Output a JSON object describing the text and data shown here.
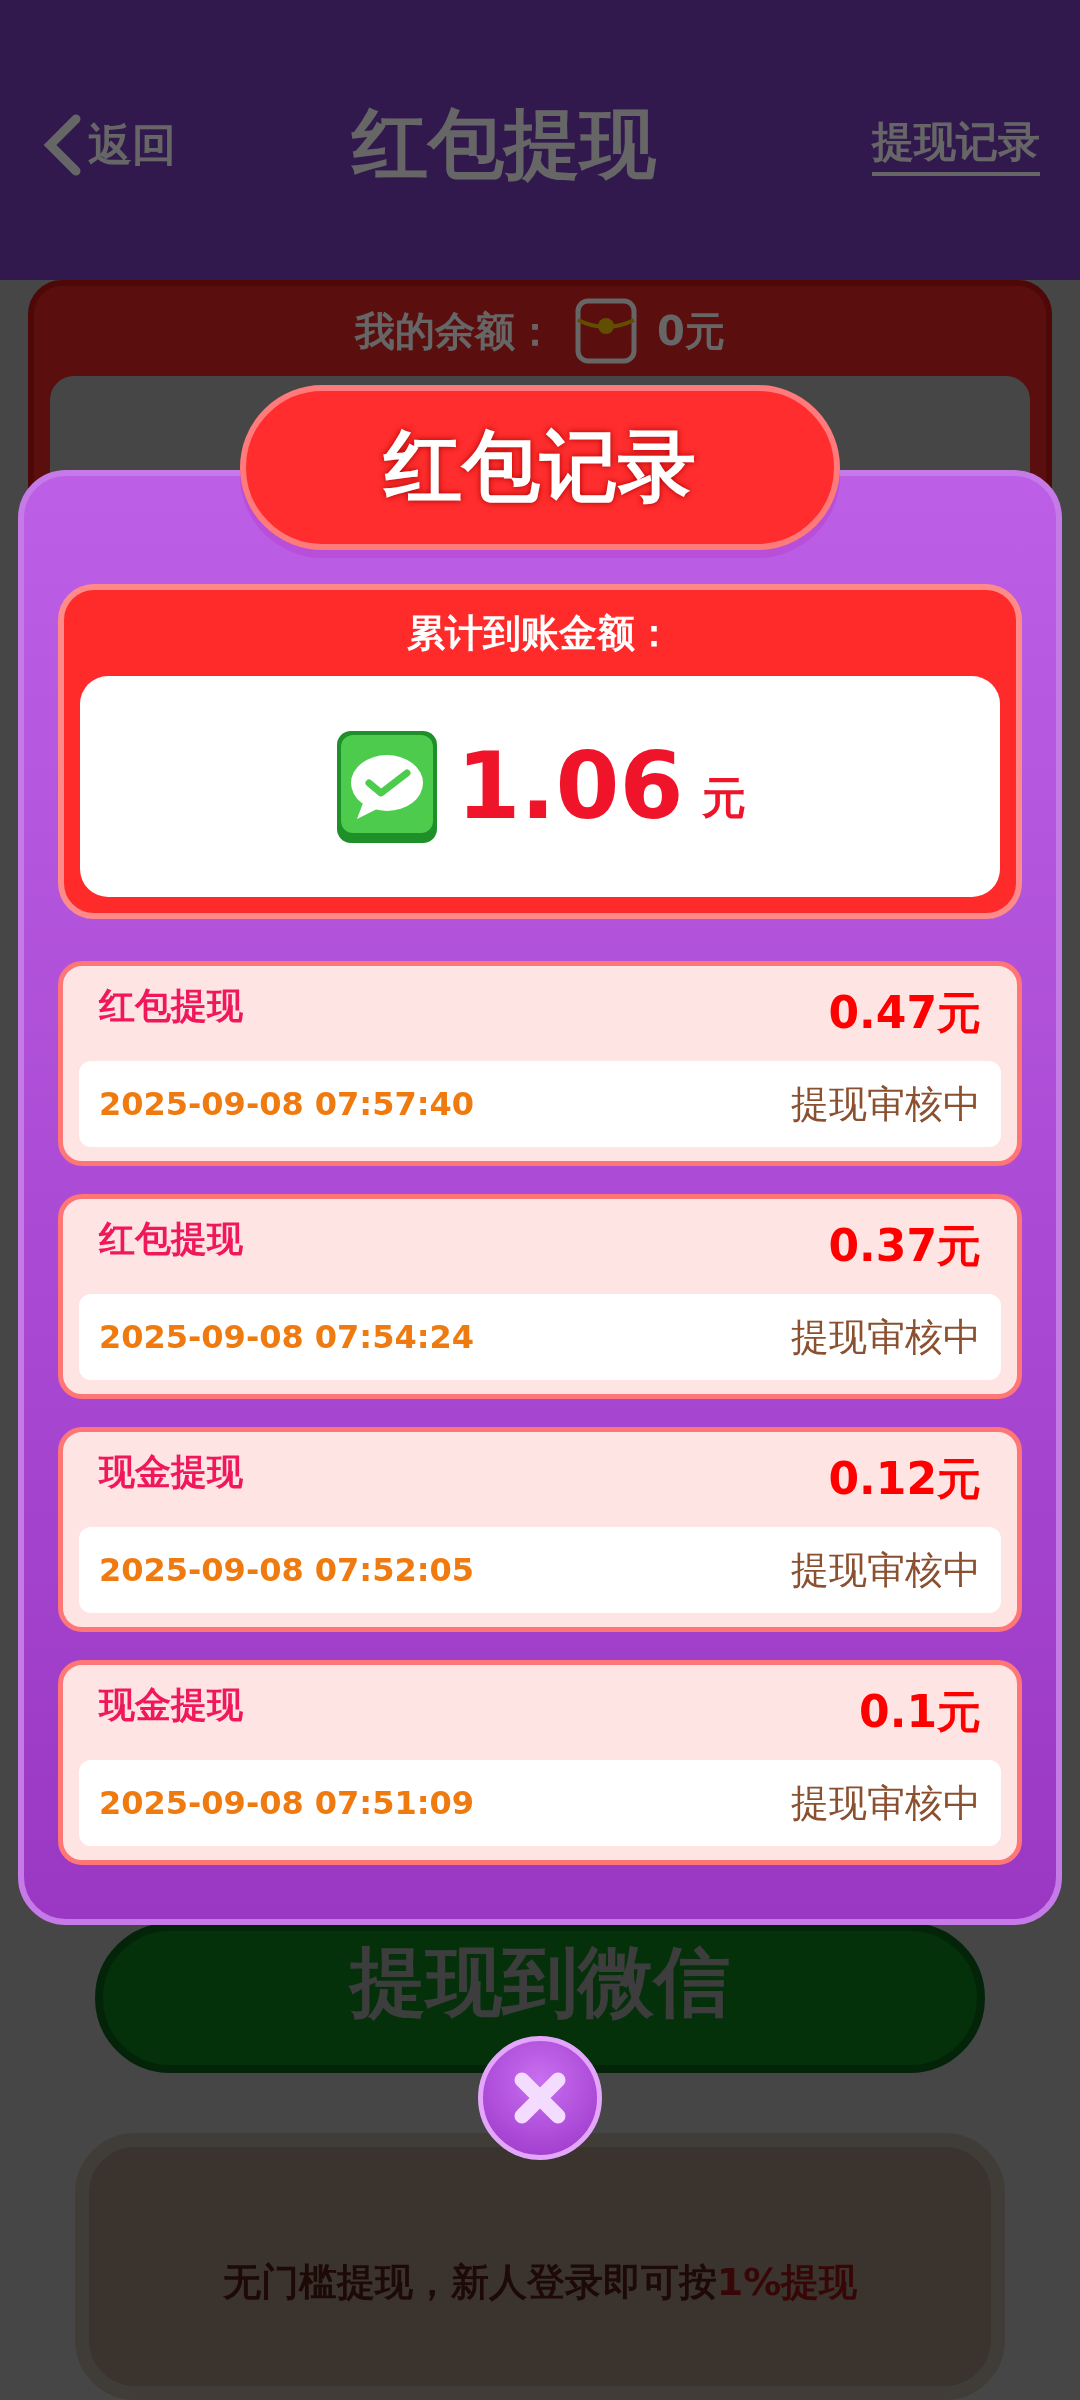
{
  "header": {
    "back": "返回",
    "title": "红包提现",
    "link": "提现记录"
  },
  "balance": {
    "label": "我的余额：",
    "value": "0元"
  },
  "withdraw_button": "提现到微信",
  "notice": "无门槛提现，新人登录即可按**1%提现**",
  "dialog": {
    "title": "红包记录",
    "total_label": "累计到账金额：",
    "total_amount": "1.06",
    "total_unit": "元",
    "records": [
      {
        "type": "红包提现",
        "amount": "0.47元",
        "time": "2025-09-08 07:57:40",
        "status": "提现审核中"
      },
      {
        "type": "红包提现",
        "amount": "0.37元",
        "time": "2025-09-08 07:54:24",
        "status": "提现审核中"
      },
      {
        "type": "现金提现",
        "amount": "0.12元",
        "time": "2025-09-08 07:52:05",
        "status": "提现审核中"
      },
      {
        "type": "现金提现",
        "amount": "0.1元",
        "time": "2025-09-08 07:51:09",
        "status": "提现审核中"
      }
    ]
  }
}
